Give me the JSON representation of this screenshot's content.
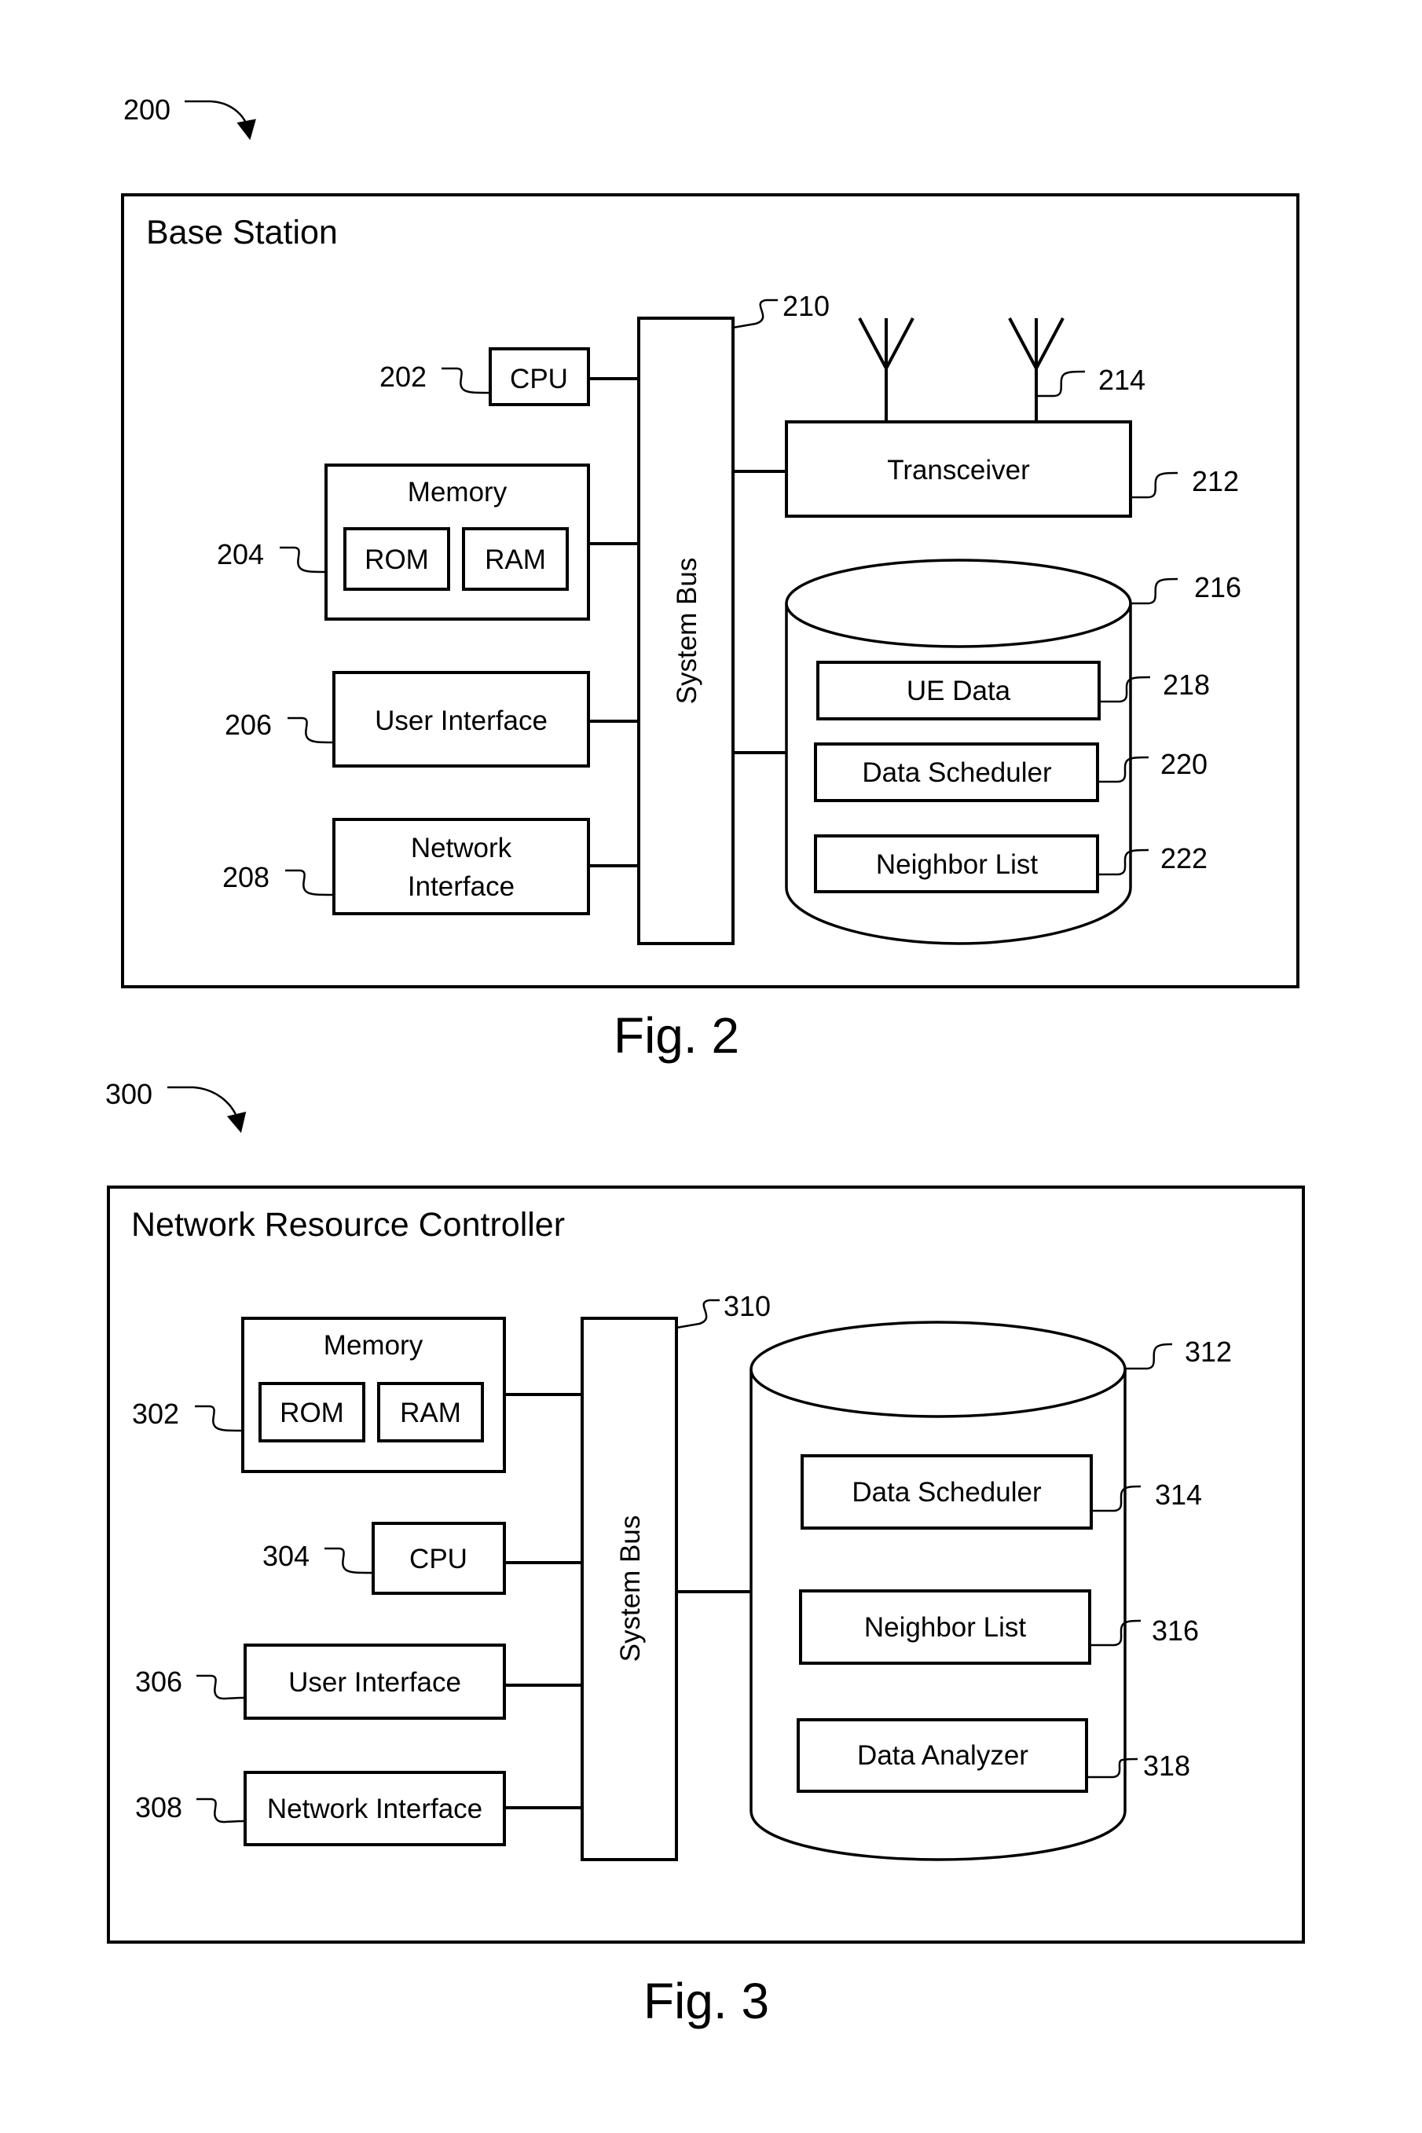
{
  "fig2": {
    "ref": "200",
    "title": "Base Station",
    "caption": "Fig. 2",
    "cpu": {
      "label": "CPU",
      "ref": "202"
    },
    "memory": {
      "label": "Memory",
      "rom": "ROM",
      "ram": "RAM",
      "ref": "204"
    },
    "user_interface": {
      "label": "User Interface",
      "ref": "206"
    },
    "network_interface": {
      "label_line1": "Network",
      "label_line2": "Interface",
      "ref": "208"
    },
    "system_bus": {
      "label": "System Bus",
      "ref": "210"
    },
    "transceiver": {
      "label": "Transceiver",
      "ref": "212"
    },
    "antennas": {
      "ref": "214"
    },
    "storage": {
      "ref": "216"
    },
    "ue_data": {
      "label": "UE Data",
      "ref": "218"
    },
    "data_scheduler": {
      "label": "Data Scheduler",
      "ref": "220"
    },
    "neighbor_list": {
      "label": "Neighbor List",
      "ref": "222"
    }
  },
  "fig3": {
    "ref": "300",
    "title": "Network Resource Controller",
    "caption": "Fig. 3",
    "memory": {
      "label": "Memory",
      "rom": "ROM",
      "ram": "RAM",
      "ref": "302"
    },
    "cpu": {
      "label": "CPU",
      "ref": "304"
    },
    "user_interface": {
      "label": "User Interface",
      "ref": "306"
    },
    "network_interface": {
      "label": "Network Interface",
      "ref": "308"
    },
    "system_bus": {
      "label": "System Bus",
      "ref": "310"
    },
    "storage": {
      "ref": "312"
    },
    "data_scheduler": {
      "label": "Data Scheduler",
      "ref": "314"
    },
    "neighbor_list": {
      "label": "Neighbor List",
      "ref": "316"
    },
    "data_analyzer": {
      "label": "Data Analyzer",
      "ref": "318"
    }
  }
}
